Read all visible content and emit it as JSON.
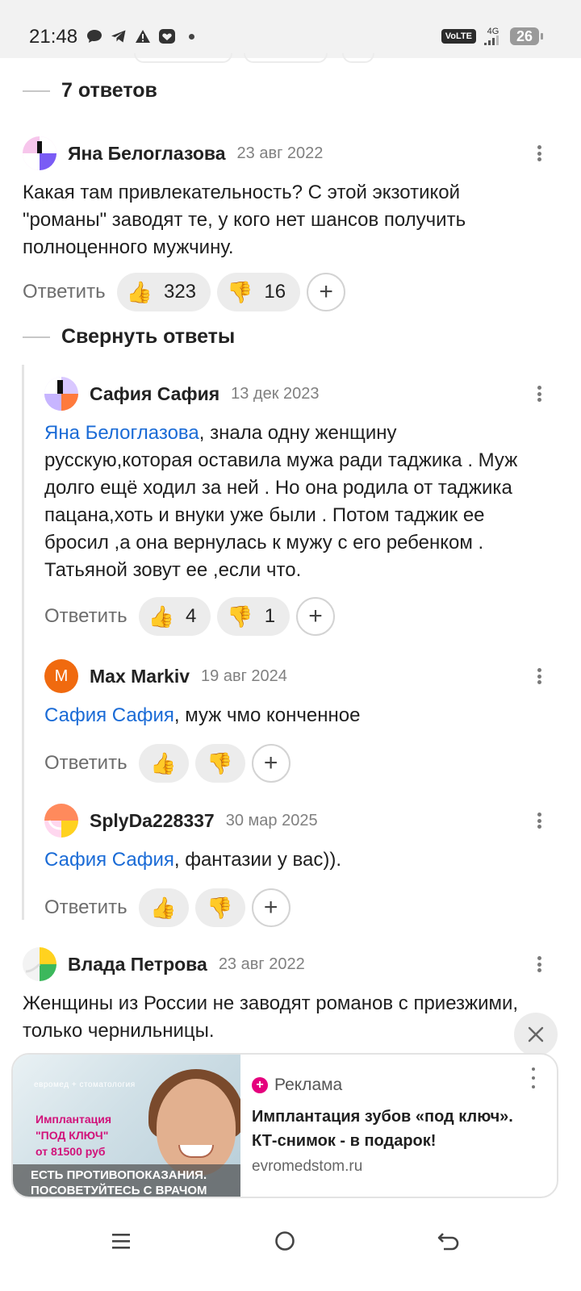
{
  "status_bar": {
    "time": "21:48",
    "left_icons": [
      "chat-bubble-icon",
      "telegram-icon",
      "warning-icon",
      "heart-shield-icon",
      "dot-icon"
    ],
    "volte": "VoLTE",
    "network": "4G",
    "battery": "26"
  },
  "threads": {
    "replies_count_label": "7 ответов",
    "collapse_label": "Свернуть ответы"
  },
  "comments": [
    {
      "author": "Яна Белоглазова",
      "date": "23 авг 2022",
      "mention": "",
      "text": "Какая там привлекательность? С этой экзотикой \"романы\" заводят те, у кого нет шансов получить полноценного мужчину.",
      "reply_label": "Ответить",
      "likes": "323",
      "dislikes": "16"
    },
    {
      "author": "Сафия Сафия",
      "date": "13 дек 2023",
      "mention": "Яна Белоглазова",
      "text": ", знала одну женщину русскую,которая оставила мужа ради таджика . Муж долго ещё ходил за ней . Но она родила от таджика пацана,хоть и внуки уже были . Потом таджик ее бросил ,а она вернулась к мужу с его ребенком . Татьяной зовут ее ,если что.",
      "reply_label": "Ответить",
      "likes": "4",
      "dislikes": "1"
    },
    {
      "author": "Max Markiv",
      "date": "19 авг 2024",
      "avatar_letter": "M",
      "mention": "Сафия Сафия",
      "text": ", муж чмо конченное",
      "reply_label": "Ответить"
    },
    {
      "author": "SplyDa228337",
      "date": "30 мар 2025",
      "mention": "Сафия Сафия",
      "text": ", фантазии у вас)).",
      "reply_label": "Ответить"
    },
    {
      "author": "Влада Петрова",
      "date": "23 авг 2022",
      "mention": "",
      "text": "Женщины из России не заводят романов с приезжими, только чернильницы."
    }
  ],
  "reaction_icons": {
    "like": "thumbs-up-icon",
    "dislike": "thumbs-down-icon",
    "add": "plus-icon"
  },
  "ad": {
    "label": "Реклама",
    "title": "Имплантация зубов «под ключ». КТ-снимок - в подарок!",
    "url": "evromedstom.ru",
    "image_brand": "евромед + стоматология",
    "image_promo_line1": "Имплантация",
    "image_promo_line2": "\"ПОД КЛЮЧ\"",
    "image_promo_line3": "от 81500 руб",
    "image_warning_line1": "ЕСТЬ ПРОТИВОПОКАЗАНИЯ.",
    "image_warning_line2": "ПОСОВЕТУЙТЕСЬ С ВРАЧОМ",
    "close_icon": "close-icon"
  },
  "nav_bar": {
    "items": [
      "menu-icon",
      "home-icon",
      "back-icon"
    ]
  },
  "colors": {
    "mention": "#1a6bd6",
    "ad_brand": "#e5007d",
    "reaction_bg": "#ececec"
  }
}
